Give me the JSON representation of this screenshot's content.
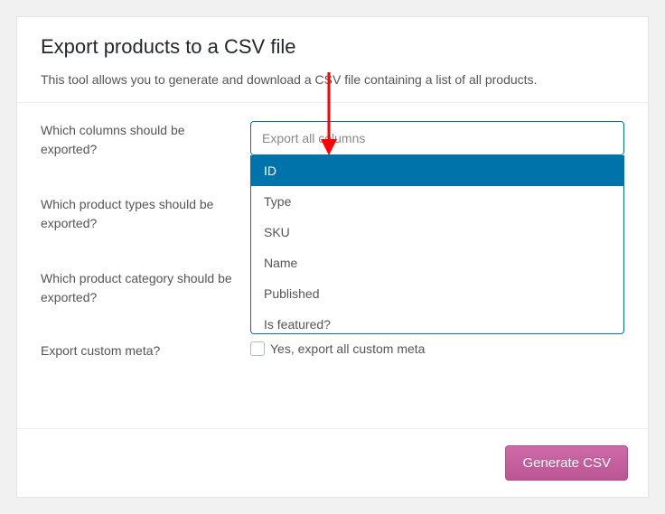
{
  "header": {
    "title": "Export products to a CSV file",
    "description": "This tool allows you to generate and download a CSV file containing a list of all products."
  },
  "rows": {
    "columns": {
      "label": "Which columns should be exported?",
      "placeholder": "Export all columns"
    },
    "types": {
      "label": "Which product types should be exported?"
    },
    "category": {
      "label": "Which product category should be exported?"
    },
    "meta": {
      "label": "Export custom meta?",
      "checkbox_label": "Yes, export all custom meta"
    }
  },
  "columns_dropdown": {
    "options": [
      "ID",
      "Type",
      "SKU",
      "Name",
      "Published",
      "Is featured?"
    ],
    "highlighted": "ID"
  },
  "footer": {
    "button": "Generate CSV"
  }
}
